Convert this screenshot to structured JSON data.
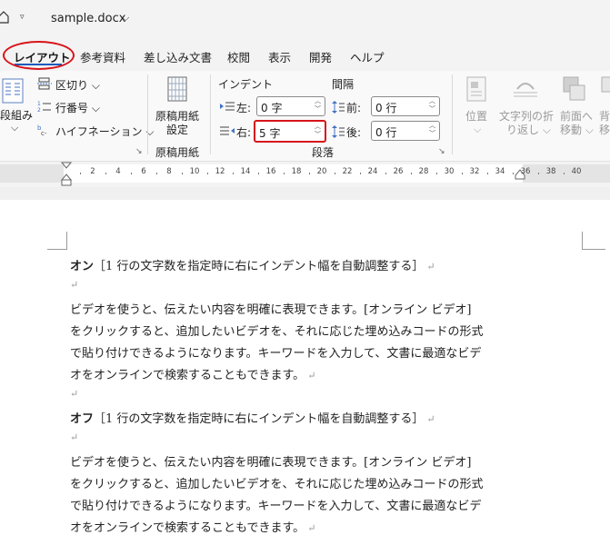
{
  "titlebar": {
    "qat_arrow": "▿",
    "document_name": "sample.docx",
    "name_chevron": "⌵"
  },
  "tabs": [
    {
      "label": "レイアウト",
      "active": true
    },
    {
      "label": "参考資料"
    },
    {
      "label": "差し込み文書"
    },
    {
      "label": "校閲"
    },
    {
      "label": "表示"
    },
    {
      "label": "開発"
    },
    {
      "label": "ヘルプ"
    }
  ],
  "ribbon": {
    "page_setup": {
      "columns_label": "段組み",
      "columns_arrow": "⌵",
      "breaks": "区切り",
      "line_numbers": "行番号",
      "hyphenation": "ハイフネーション"
    },
    "manuscript": {
      "button_line1": "原稿用紙",
      "button_line2": "設定",
      "group_label": "原稿用紙"
    },
    "paragraph": {
      "indent_header": "インデント",
      "spacing_header": "間隔",
      "indent_left_label": "左:",
      "indent_left_value": "0 字",
      "indent_right_label": "右:",
      "indent_right_value": "5 字",
      "space_before_label": "前:",
      "space_before_value": "0 行",
      "space_after_label": "後:",
      "space_after_value": "0 行",
      "group_label": "段落"
    },
    "arrange": {
      "position_label": "位置",
      "wrap_line1": "文字列の折",
      "wrap_line2": "り返し",
      "forward_line1": "前面へ",
      "forward_line2": "移動",
      "back_line1": "背",
      "back_line2": "移"
    },
    "launcher_glyph": "↘"
  },
  "ruler": {
    "ticks": [
      "2",
      "4",
      "6",
      "8",
      "10",
      "12",
      "14",
      "16",
      "18",
      "20",
      "22",
      "24",
      "26",
      "28",
      "30",
      "32",
      "34",
      "36",
      "38",
      "40"
    ]
  },
  "document": {
    "para_mark": "↵",
    "heading1_bold": "オン",
    "heading1_rest": "［1 行の文字数を指定時に右にインデント幅を自動調整する］",
    "body1": [
      "ビデオを使うと、伝えたい内容を明確に表現できます。[オンライン ビデオ]",
      "をクリックすると、追加したいビデオを、それに応じた埋め込みコードの形式",
      "で貼り付けできるようになります。キーワードを入力して、文書に最適なビデ",
      "オをオンラインで検索することもできます。"
    ],
    "heading2_bold": "オフ",
    "heading2_rest": "［1 行の文字数を指定時に右にインデント幅を自動調整する］",
    "body2": [
      "ビデオを使うと、伝えたい内容を明確に表現できます。[オンライン ビデオ]",
      "をクリックすると、追加したいビデオを、それに応じた埋め込みコードの形式",
      "で貼り付けできるようになります。キーワードを入力して、文書に最適なビデ",
      "オをオンラインで検索することもできます。"
    ]
  },
  "colors": {
    "accent": "#185abd",
    "highlight_red": "#d6141a"
  }
}
